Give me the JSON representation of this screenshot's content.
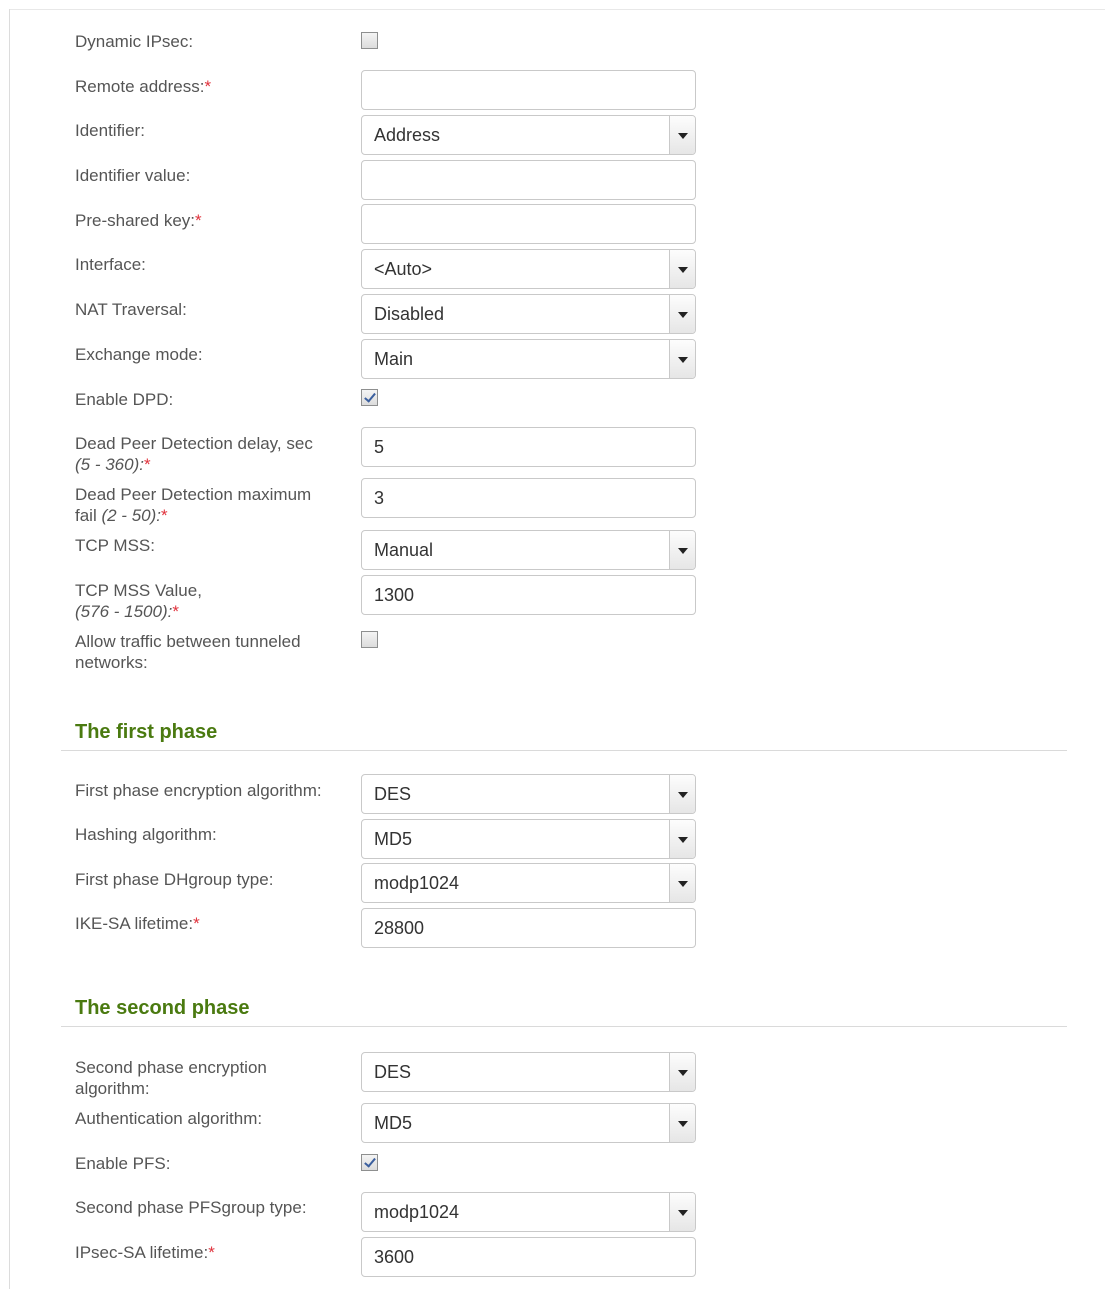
{
  "general": {
    "dynamic_ipsec": {
      "label": "Dynamic IPsec:",
      "checked": false
    },
    "remote_address": {
      "label": "Remote address:",
      "required": "*",
      "value": ""
    },
    "identifier": {
      "label": "Identifier:",
      "value": "Address"
    },
    "identifier_value": {
      "label": "Identifier value:",
      "value": ""
    },
    "pre_shared_key": {
      "label": "Pre-shared key:",
      "required": "*",
      "value": ""
    },
    "interface": {
      "label": "Interface:",
      "value": "<Auto>"
    },
    "nat_traversal": {
      "label": "NAT Traversal:",
      "value": "Disabled"
    },
    "exchange_mode": {
      "label": "Exchange mode:",
      "value": "Main"
    },
    "enable_dpd": {
      "label": "Enable DPD:",
      "checked": true
    },
    "dpd_delay": {
      "label": "Dead Peer Detection delay, sec",
      "range": "(5 - 360):",
      "required": "*",
      "value": "5"
    },
    "dpd_max_fail": {
      "label_line1": "Dead Peer Detection maximum",
      "label_line2": "fail",
      "range": "(2 - 50):",
      "required": "*",
      "value": "3"
    },
    "tcp_mss": {
      "label": "TCP MSS:",
      "value": "Manual"
    },
    "tcp_mss_value": {
      "label": "TCP MSS Value,",
      "range": "(576 - 1500):",
      "required": "*",
      "value": "1300"
    },
    "allow_traffic": {
      "label_line1": "Allow traffic between tunneled",
      "label_line2": "networks:",
      "checked": false
    }
  },
  "phase1": {
    "title": "The first phase",
    "encryption": {
      "label": "First phase encryption algorithm:",
      "value": "DES"
    },
    "hashing": {
      "label": "Hashing algorithm:",
      "value": "MD5"
    },
    "dhgroup": {
      "label": "First phase DHgroup type:",
      "value": "modp1024"
    },
    "ike_lifetime": {
      "label": "IKE-SA lifetime:",
      "required": "*",
      "value": "28800"
    }
  },
  "phase2": {
    "title": "The second phase",
    "encryption": {
      "label_line1": "Second phase encryption",
      "label_line2": "algorithm:",
      "value": "DES"
    },
    "auth": {
      "label": "Authentication algorithm:",
      "value": "MD5"
    },
    "enable_pfs": {
      "label": "Enable PFS:",
      "checked": true
    },
    "pfs_group": {
      "label": "Second phase PFSgroup type:",
      "value": "modp1024"
    },
    "ipsec_lifetime": {
      "label": "IPsec-SA lifetime:",
      "required": "*",
      "value": "3600"
    }
  }
}
